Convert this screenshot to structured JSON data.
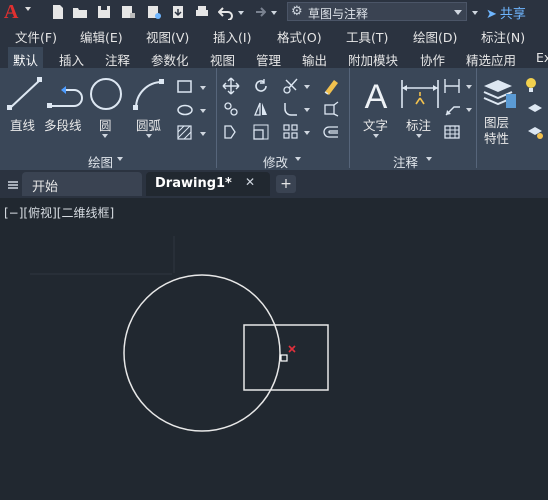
{
  "app": {
    "logo": "A"
  },
  "quick_access": {
    "workspace": "草图与注释",
    "share_label": "共享"
  },
  "menu": {
    "items": [
      "文件(F)",
      "编辑(E)",
      "视图(V)",
      "插入(I)",
      "格式(O)",
      "工具(T)",
      "绘图(D)",
      "标注(N)"
    ]
  },
  "ribbon_tabs": {
    "items": [
      "默认",
      "插入",
      "注释",
      "参数化",
      "视图",
      "管理",
      "输出",
      "附加模块",
      "协作",
      "精选应用",
      "Ex"
    ],
    "active": "默认"
  },
  "ribbon": {
    "draw": {
      "line": "直线",
      "polyline": "多段线",
      "circle": "圆",
      "arc": "圆弧",
      "panel_title": "绘图"
    },
    "modify": {
      "panel_title": "修改"
    },
    "annotation": {
      "text": "文字",
      "dimension": "标注",
      "panel_title": "注释"
    },
    "layers": {
      "layer_properties": "图层特性"
    }
  },
  "doc_tabs": {
    "start": "开始",
    "drawing": "Drawing1*",
    "close": "✕",
    "add": "+"
  },
  "viewport": {
    "label": "[−][俯视][二维线框]"
  },
  "colors": {
    "background": "#212830",
    "panel": "#3a4758",
    "accent": "#6fb6ff",
    "brand_red": "#e03030"
  }
}
